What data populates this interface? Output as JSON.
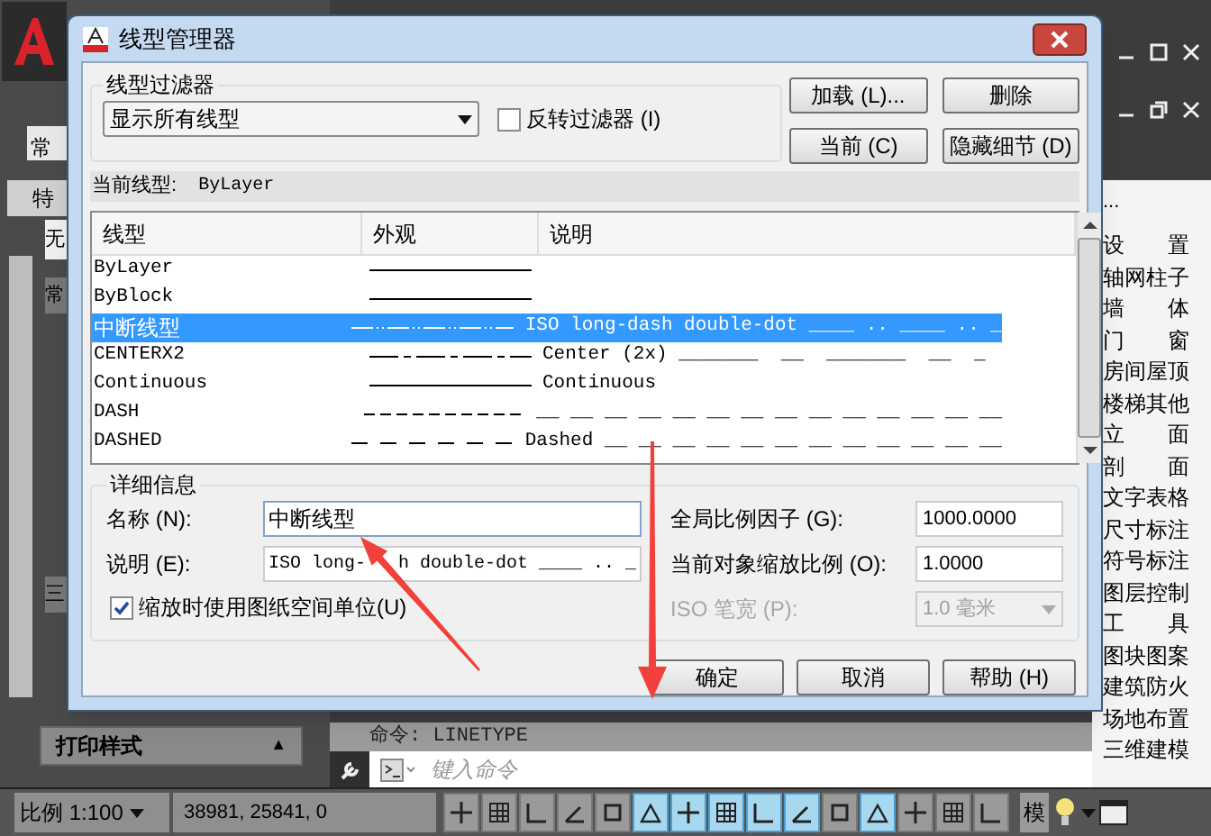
{
  "app": {
    "left_tabs": [
      "常",
      "特"
    ],
    "left_buttons": [
      "无",
      "常",
      "三"
    ],
    "print_panel": {
      "title": "打印样式",
      "toggle": "▲"
    },
    "palette": {
      "header": "...",
      "items": [
        "设　　置",
        "轴网柱子",
        "墙　　体",
        "门　　窗",
        "房间屋顶",
        "楼梯其他",
        "立　　面",
        "剖　　面",
        "文字表格",
        "尺寸标注",
        "符号标注",
        "图层控制",
        "工　　具",
        "图块图案",
        "建筑防火",
        "场地布置",
        "三维建模"
      ]
    },
    "command": {
      "history": "命令: LINETYPE",
      "placeholder": "键入命令"
    },
    "status_bar": {
      "scale": "比例 1:100",
      "coords": "38981, 25841, 0",
      "model": "模",
      "toggles": [
        {
          "on": false
        },
        {
          "on": false
        },
        {
          "on": false
        },
        {
          "on": false
        },
        {
          "on": false
        },
        {
          "on": true
        },
        {
          "on": true
        },
        {
          "on": true
        },
        {
          "on": true
        },
        {
          "on": true
        },
        {
          "on": false
        },
        {
          "on": true
        },
        {
          "on": false
        },
        {
          "on": false
        },
        {
          "on": false
        }
      ]
    }
  },
  "dialog": {
    "title": "线型管理器",
    "filter": {
      "legend": "线型过滤器",
      "value": "显示所有线型",
      "invert": {
        "label": "反转过滤器 (I)",
        "checked": false
      }
    },
    "buttons": [
      "加载 (L)...",
      "删除",
      "当前 (C)",
      "隐藏细节 (D)"
    ],
    "current": {
      "label": "当前线型:",
      "value": "ByLayer"
    },
    "table": {
      "columns": [
        "线型",
        "外观",
        "说明"
      ],
      "rows": [
        {
          "name": "ByLayer",
          "kind": "solid",
          "description": "",
          "selected": false
        },
        {
          "name": "ByBlock",
          "kind": "solid",
          "description": "",
          "selected": false
        },
        {
          "name": "中断线型",
          "kind": "dashdotdot",
          "description": "ISO long-dash double-dot ____ .. ____ .. _",
          "selected": true
        },
        {
          "name": "CENTERX2",
          "kind": "center",
          "description": "Center (2x) _______  __  _______  __  _",
          "selected": false
        },
        {
          "name": "Continuous",
          "kind": "solid",
          "description": "Continuous",
          "selected": false
        },
        {
          "name": "DASH",
          "kind": "dash",
          "description": "__ __ __ __ __ __ __ __ __ __ __ __ __ __",
          "selected": false
        },
        {
          "name": "DASHED",
          "kind": "dashed",
          "description": "Dashed __ __ __ __ __ __ __ __ __ __ __ __",
          "selected": false
        }
      ]
    },
    "details": {
      "legend": "详细信息",
      "name": {
        "label": "名称 (N):",
        "value": "中断线型"
      },
      "description": {
        "label": "说明 (E):",
        "value": "ISO long-   h double-dot ____ .. _"
      },
      "paper_units": {
        "label": "缩放时使用图纸空间单位(U)",
        "checked": true
      },
      "global_scale": {
        "label": "全局比例因子 (G):",
        "value": "1000.0000"
      },
      "object_scale": {
        "label": "当前对象缩放比例 (O):",
        "value": "1.0000"
      },
      "pen_width": {
        "label": "ISO 笔宽 (P):",
        "value": "1.0 毫米",
        "disabled": true
      }
    },
    "footer_buttons": [
      "确定",
      "取消",
      "帮助 (H)"
    ]
  }
}
